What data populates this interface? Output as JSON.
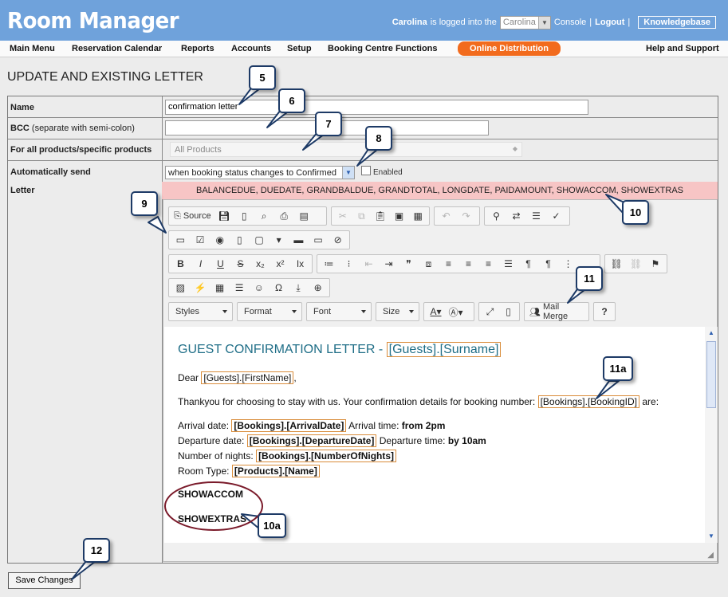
{
  "header": {
    "logo": "Room Manager",
    "user_name": "Carolina",
    "logged_text": "is logged into the",
    "console_value": "Carolina",
    "console_text": "Console",
    "separator": "|",
    "logout": "Logout",
    "knowledgebase": "Knowledgebase"
  },
  "menu": {
    "main_menu": "Main Menu",
    "reservation_calendar": "Reservation Calendar",
    "reports": "Reports",
    "accounts": "Accounts",
    "setup": "Setup",
    "booking_centre": "Booking Centre Functions",
    "online_distribution": "Online Distribution",
    "help": "Help and Support"
  },
  "page_title": "UPDATE AND EXISTING LETTER",
  "form": {
    "name_label": "Name",
    "name_value": "confirmation letter",
    "bcc_label": "BCC",
    "bcc_hint": "(separate with semi-colon)",
    "bcc_value": "",
    "products_label": "For all products/specific products",
    "products_value": "All Products",
    "autosend_label": "Automatically send",
    "autosend_value": "when booking status changes to Confirmed",
    "enabled_label": "Enabled",
    "letter_label": "Letter",
    "merge_fields": "BALANCEDUE, DUEDATE, GRANDBALDUE, GRANDTOTAL, LONGDATE, PAIDAMOUNT, SHOWACCOM, SHOWEXTRAS"
  },
  "toolbar": {
    "source": "Source",
    "styles": "Styles",
    "format": "Format",
    "font": "Font",
    "size": "Size",
    "mail_merge": "Mail Merge",
    "help": "?"
  },
  "letter": {
    "heading_text": "GUEST CONFIRMATION LETTER - ",
    "heading_tag": "[Guests].[Surname]",
    "dear": "Dear",
    "dear_tag": "[Guests].[FirstName]",
    "dear_comma": ",",
    "thanks": "Thankyou for choosing to stay with us. Your confirmation details for booking number:",
    "booking_tag": "[Bookings].[BookingID]",
    "are": "are:",
    "arrival_label": "Arrival date:",
    "arrival_tag": "[Bookings].[ArrivalDate]",
    "arrival_time_label": "Arrival time:",
    "arrival_time": "from 2pm",
    "departure_label": "Departure date:",
    "departure_tag": "[Bookings].[DepartureDate]",
    "departure_time_label": "Departure time:",
    "departure_time": "by 10am",
    "nights_label": "Number of nights:",
    "nights_tag": "[Bookings].[NumberOfNights]",
    "room_label": "Room Type:",
    "room_tag": "[Products].[Name]",
    "showaccom": "SHOWACCOM",
    "showextras": "SHOWEXTRAS"
  },
  "save_button": "Save Changes",
  "callouts": {
    "c5": "5",
    "c6": "6",
    "c7": "7",
    "c8": "8",
    "c9": "9",
    "c10": "10",
    "c10a": "10a",
    "c11": "11",
    "c11a": "11a",
    "c12": "12"
  },
  "colors": {
    "header_bg": "#6fa2db",
    "accent_orange": "#f26b1d",
    "merge_bar": "#f7c5c5",
    "heading_teal": "#1f6e87",
    "tag_border": "#d98c3a",
    "circle_maroon": "#7a1a2a"
  }
}
